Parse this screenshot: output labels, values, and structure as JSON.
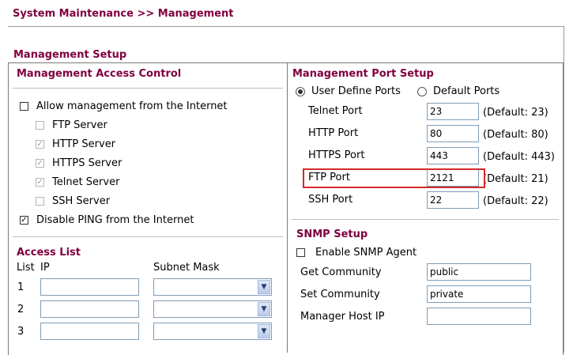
{
  "page": {
    "title": "System Maintenance >> Management"
  },
  "management_setup": {
    "title": "Management Setup",
    "access_control": {
      "title": "Management Access Control",
      "allow_internet": {
        "label": "Allow management from the Internet",
        "checked": false
      },
      "servers": [
        {
          "label": "FTP Server",
          "checked": false
        },
        {
          "label": "HTTP Server",
          "checked": true
        },
        {
          "label": "HTTPS Server",
          "checked": true
        },
        {
          "label": "Telnet Server",
          "checked": true
        },
        {
          "label": "SSH Server",
          "checked": false
        }
      ],
      "disable_ping": {
        "label": "Disable PING from the Internet",
        "checked": true
      }
    },
    "access_list": {
      "title": "Access List",
      "headers": {
        "list": "List",
        "ip": "IP",
        "subnet": "Subnet Mask"
      },
      "rows": [
        {
          "num": "1"
        },
        {
          "num": "2"
        },
        {
          "num": "3"
        }
      ]
    },
    "port_setup": {
      "title": "Management Port Setup",
      "mode_user": "User Define Ports",
      "mode_default": "Default Ports",
      "selected_mode": "user",
      "ports": [
        {
          "label": "Telnet Port",
          "value": "23",
          "default": "(Default: 23)"
        },
        {
          "label": "HTTP Port",
          "value": "80",
          "default": "(Default: 80)"
        },
        {
          "label": "HTTPS Port",
          "value": "443",
          "default": "(Default: 443)"
        },
        {
          "label": "FTP Port",
          "value": "2121",
          "default": "(Default: 21)"
        },
        {
          "label": "SSH Port",
          "value": "22",
          "default": "(Default: 22)"
        }
      ]
    },
    "snmp": {
      "title": "SNMP Setup",
      "enable_agent": {
        "label": "Enable SNMP Agent",
        "checked": false
      },
      "get_community": {
        "label": "Get Community",
        "value": "public"
      },
      "set_community": {
        "label": "Set Community",
        "value": "private"
      },
      "manager_host": {
        "label": "Manager Host IP",
        "value": ""
      }
    }
  },
  "colors": {
    "heading": "#800040",
    "highlight": "#d42a2a",
    "input_border": "#7f9db9"
  }
}
